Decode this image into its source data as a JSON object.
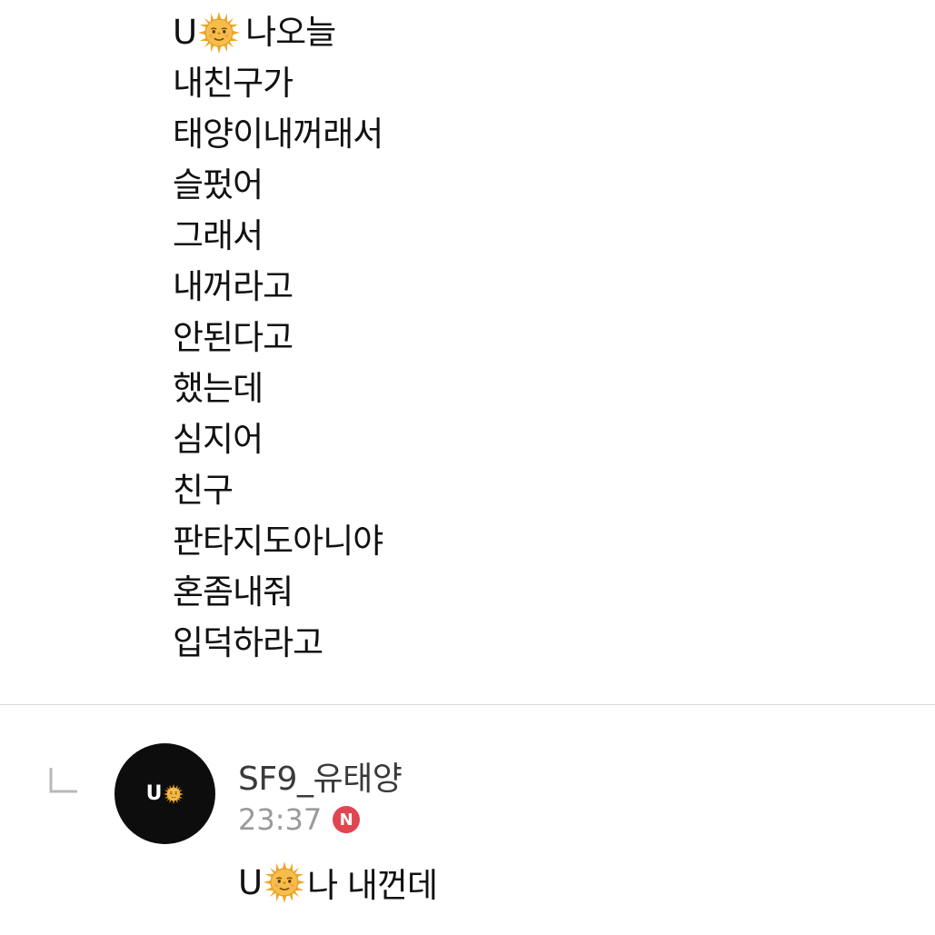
{
  "post": {
    "first_line": {
      "prefix": "U",
      "emoji": "sun-with-face-icon",
      "text": "나오늘"
    },
    "lines": [
      "내친구가",
      "태양이내꺼래서",
      "슬펐어",
      "그래서",
      "내꺼라고",
      "안된다고",
      "했는데",
      "심지어",
      "친구",
      "판타지도아니야",
      "혼좀내줘",
      "입덕하라고"
    ]
  },
  "reply": {
    "icon": "reply-arrow-icon",
    "avatar": {
      "text": "U",
      "emoji": "sun-with-face-icon"
    },
    "author": "SF9_유태양",
    "time": "23:37",
    "badge": "N",
    "message": {
      "prefix": "U",
      "emoji": "sun-with-face-icon",
      "text": "나 내껀데"
    }
  },
  "colors": {
    "badge": "#e0464f",
    "avatar_bg": "#0d0d0d",
    "sun": "#f4b43a",
    "meta_text": "#9a9a9a"
  }
}
